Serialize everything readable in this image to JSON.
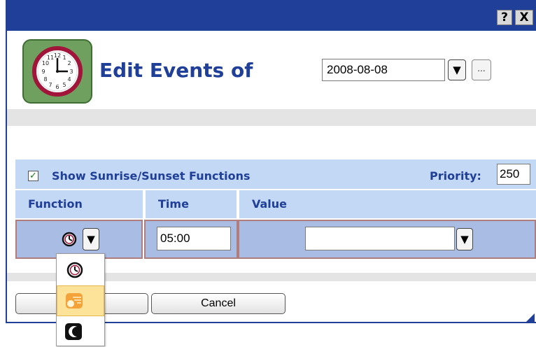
{
  "titlebar": {
    "help_label": "?",
    "close_label": "X"
  },
  "header": {
    "title": "Edit Events of",
    "date_value": "2008-08-08",
    "date_dropdown_glyph": "▼",
    "date_picker_label": "..."
  },
  "options": {
    "show_sun_label": "Show Sunrise/Sunset Functions",
    "show_sun_checked": true,
    "check_glyph": "✓",
    "priority_label": "Priority:",
    "priority_value": "250"
  },
  "table": {
    "columns": [
      "Function",
      "Time",
      "Value"
    ],
    "row": {
      "function_icon": "clock-icon",
      "function_dropdown_glyph": "▼",
      "time_value": "05:00",
      "value_value": "",
      "value_dropdown_glyph": "▼"
    }
  },
  "function_menu": {
    "items": [
      {
        "icon": "clock-icon",
        "selected": false
      },
      {
        "icon": "sunrise-icon",
        "selected": true
      },
      {
        "icon": "moon-icon",
        "selected": false
      }
    ]
  },
  "buttons": {
    "ok_label": "",
    "cancel_label": "Cancel"
  },
  "colors": {
    "window_frame": "#1f3f99",
    "title_text": "#1f3f99",
    "header_band": "#c3d8f5",
    "row_fill": "#a9bde4",
    "row_border": "#b07c7c",
    "menu_selected": "#fde29a"
  }
}
